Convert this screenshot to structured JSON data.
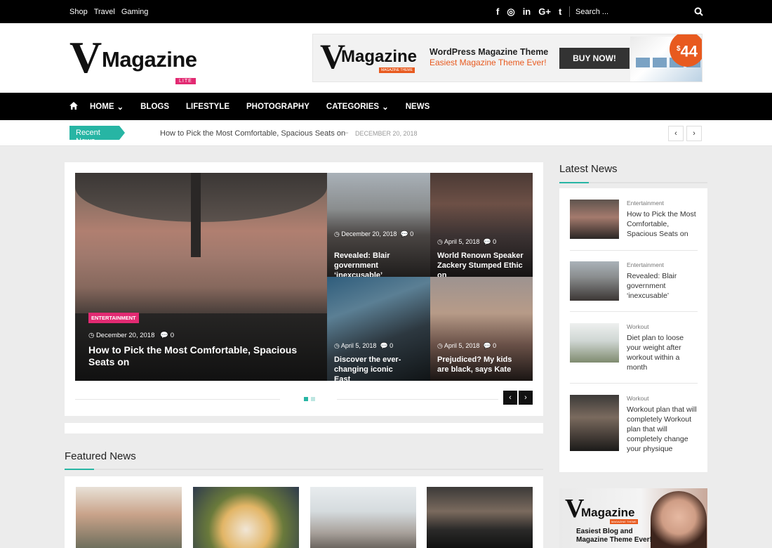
{
  "topbar": {
    "links": [
      "Shop",
      "Travel",
      "Gaming"
    ],
    "social": [
      "f",
      "◎",
      "in",
      "G+",
      "t"
    ],
    "search_placeholder": "Search ..."
  },
  "brand": {
    "v": "V",
    "word": "Magazine",
    "badge": "LITE"
  },
  "ad": {
    "v": "V",
    "word": "Magazine",
    "tag": "MAGAZINE THEME",
    "line1": "WordPress Magazine Theme",
    "line2": "Easiest  Magazine Theme Ever!",
    "button": "BUY NOW!",
    "price": "44",
    "currency": "$"
  },
  "nav": {
    "items": [
      "HOME",
      "BLOGS",
      "LIFESTYLE",
      "PHOTOGRAPHY",
      "CATEGORIES",
      "NEWS"
    ]
  },
  "ticker": {
    "label": "Recent News",
    "title": "How to Pick the Most Comfortable, Spacious Seats on",
    "dash": "–",
    "date": "DECEMBER 20, 2018"
  },
  "slider": {
    "main": {
      "category": "ENTERTAINMENT",
      "date": "December 20, 2018",
      "comments": "0",
      "title": "How to Pick the Most Comfortable, Spacious Seats on"
    },
    "grid": [
      {
        "date": "December 20, 2018",
        "comments": "0",
        "title": "Revealed: Blair government ‘inexcusable’"
      },
      {
        "date": "April 5, 2018",
        "comments": "0",
        "title": "World Renown Speaker Zackery Stumped Ethic on"
      },
      {
        "date": "April 5, 2018",
        "comments": "0",
        "title": "Discover the ever-changing iconic East"
      },
      {
        "date": "April 5, 2018",
        "comments": "0",
        "title": "Prejudiced? My kids are black, says Kate"
      }
    ]
  },
  "featured": {
    "title": "Featured News"
  },
  "sidebar": {
    "title": "Latest News",
    "items": [
      {
        "category": "Entertainment",
        "title": "How to Pick the Most Comfortable, Spacious Seats on"
      },
      {
        "category": "Entertainment",
        "title": "Revealed: Blair government ‘inexcusable’"
      },
      {
        "category": "Workout",
        "title": "Diet plan to loose your weight after workout within a month"
      },
      {
        "category": "Workout",
        "title": "Workout plan that will completely Workout plan that will completely change your physique"
      }
    ]
  },
  "ad2": {
    "v": "V",
    "word": "Magazine",
    "tag": "MAGAZINE THEME",
    "text": "Easiest Blog and Magazine Theme Ever!"
  },
  "colors": {
    "accent": "#27b5a4",
    "pink": "#e22a72",
    "orange": "#e85a1f"
  }
}
